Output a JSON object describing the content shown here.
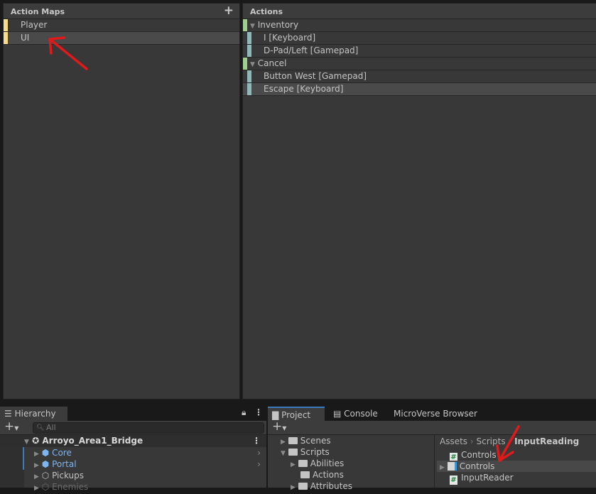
{
  "action_maps": {
    "title": "Action Maps",
    "add": "+",
    "items": [
      {
        "label": "Player",
        "selected": false
      },
      {
        "label": "UI",
        "selected": true
      }
    ]
  },
  "actions": {
    "title": "Actions",
    "items": [
      {
        "label": "Inventory",
        "type": "action"
      },
      {
        "label": "I [Keyboard]",
        "type": "binding"
      },
      {
        "label": "D-Pad/Left [Gamepad]",
        "type": "binding"
      },
      {
        "label": "Cancel",
        "type": "action"
      },
      {
        "label": "Button West [Gamepad]",
        "type": "binding"
      },
      {
        "label": "Escape [Keyboard]",
        "type": "binding",
        "selected": true
      }
    ]
  },
  "hierarchy": {
    "tab": "Hierarchy",
    "search_placeholder": "All",
    "scene": "Arroyo_Area1_Bridge",
    "items": [
      {
        "label": "Core",
        "prefab": true
      },
      {
        "label": "Portal",
        "prefab": true
      },
      {
        "label": "Pickups",
        "prefab": false
      },
      {
        "label": "Enemies",
        "prefab": false,
        "disabled": true
      }
    ]
  },
  "project": {
    "tabs": [
      "Project",
      "Console",
      "MicroVerse Browser"
    ],
    "folders": [
      {
        "label": "Scenes",
        "depth": 0
      },
      {
        "label": "Scripts",
        "depth": 0,
        "open": true
      },
      {
        "label": "Abilities",
        "depth": 1
      },
      {
        "label": "Actions",
        "depth": 1
      },
      {
        "label": "Attributes",
        "depth": 1
      }
    ],
    "breadcrumb": [
      "Assets",
      "Scripts",
      "InputReading"
    ],
    "files": [
      {
        "label": "Controls",
        "icon": "script"
      },
      {
        "label": "Controls",
        "icon": "input-actions"
      },
      {
        "label": "InputReader",
        "icon": "script"
      }
    ]
  },
  "colors": {
    "map_bar": "#f7dc8b",
    "action_bar": "#9fcf8e",
    "binding_bar": "#8fb8b8",
    "accent": "#3a79bb",
    "prefab": "#7fb5ef",
    "annotation": "#e01a1a"
  }
}
